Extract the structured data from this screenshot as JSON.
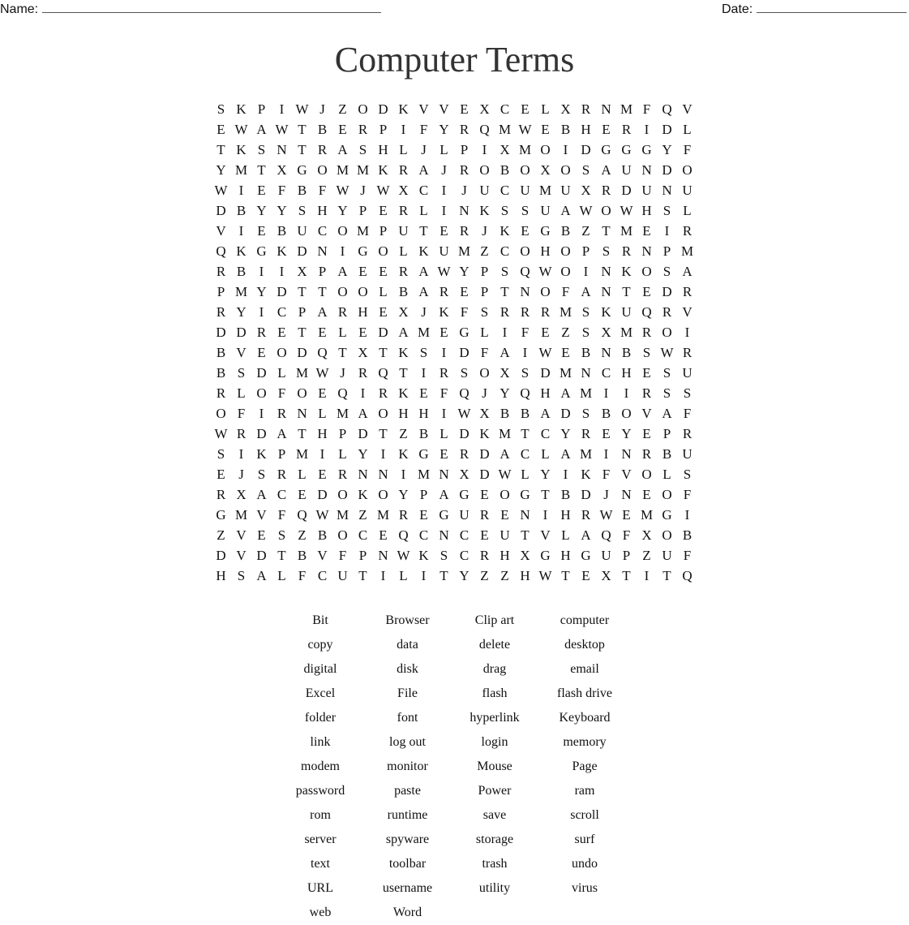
{
  "header": {
    "name_label": "Name:",
    "date_label": "Date:"
  },
  "title": "Computer Terms",
  "grid": [
    "SKPIWJZODKVVEXCELXRNMFQV",
    "EWAWTBERPIFYRQMWEBHERIDL",
    "TKSNTRASHLJLPIXMOIDGGGYF",
    "YMTXGOMMKRAJROBOXOSAUNDO",
    "WIEFBFWJWXCIJUCUMUXRDUNU",
    "DBYYSHYPERLINKSSUAWOWHSL",
    "VIEBUCOMPUTERJKEGBZTMEIR",
    "QKGKDNIGOLKUMZCOHOPSRNPM",
    "RBIIXPAEERAWYPSQWOINKOSA",
    "PMYDTTOOLBAREPTNOFANTEDR",
    "RYICPARHEXJKFSRRRMSKUQRV",
    "DDRETELEDAMEGLIFEZSXMROI",
    "BVEODQTXTKSIDFAIWEBNBSWR",
    "BSDLMWJRQTIRSOXSDMNCHESU",
    "RLOFOEQIRKEFQJYQHAMIIRSS",
    "OFIRNLMAOHHIWXBBADSBOVAF",
    "WRDATHPDTZBLDKMTCYREYEPR",
    "SIKPMILYIKGERDACLAMINRBU",
    "EJSRLERNNIMNXDWLYIKFVOLS",
    "RXACEDOKOYPAGEOGTBDJNEOF",
    "GMVFQWMZMREGURENIHRWEMGI",
    "ZVESZBOCEQCNCEUTVLAQFXOB",
    "DVDTBVFPNWKSCRHXGHGUPZUF",
    "HSALFCUTILITYZZHWTEXTITQ"
  ],
  "words": [
    "Bit",
    "Browser",
    "Clip art",
    "computer",
    "copy",
    "data",
    "delete",
    "desktop",
    "digital",
    "disk",
    "drag",
    "email",
    "Excel",
    "File",
    "flash",
    "flash drive",
    "folder",
    "font",
    "hyperlink",
    "Keyboard",
    "link",
    "log out",
    "login",
    "memory",
    "modem",
    "monitor",
    "Mouse",
    "Page",
    "password",
    "paste",
    "Power",
    "ram",
    "rom",
    "runtime",
    "save",
    "scroll",
    "server",
    "spyware",
    "storage",
    "surf",
    "text",
    "toolbar",
    "trash",
    "undo",
    "URL",
    "username",
    "utility",
    "virus",
    "web",
    "Word"
  ]
}
